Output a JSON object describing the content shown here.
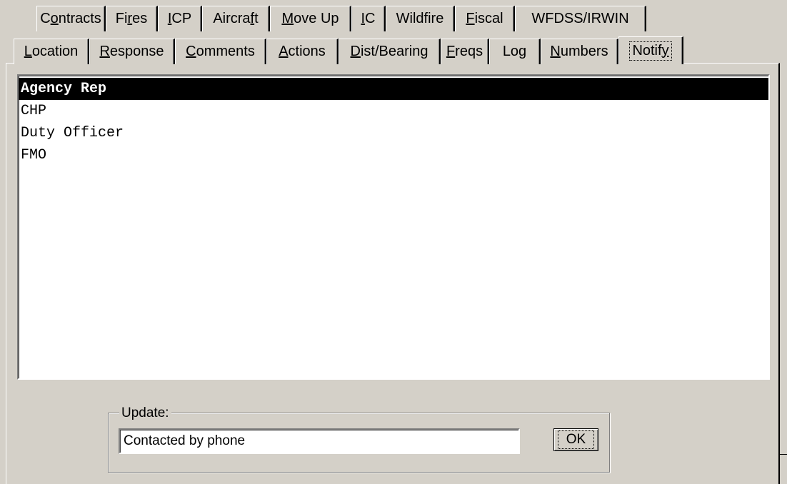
{
  "tabs_top": [
    {
      "pre": "C",
      "key": "o",
      "post": "ntracts"
    },
    {
      "pre": "Fi",
      "key": "r",
      "post": "es"
    },
    {
      "pre": "",
      "key": "I",
      "post": "CP"
    },
    {
      "pre": "Aircra",
      "key": "f",
      "post": "t"
    },
    {
      "pre": "",
      "key": "M",
      "post": "ove Up"
    },
    {
      "pre": "",
      "key": "I",
      "post": "C"
    },
    {
      "pre": "Wildfire",
      "key": "",
      "post": ""
    },
    {
      "pre": "",
      "key": "F",
      "post": "iscal"
    },
    {
      "pre": "WFDSS/IRWIN",
      "key": "",
      "post": ""
    }
  ],
  "tabs_bottom": [
    {
      "pre": "",
      "key": "L",
      "post": "ocation"
    },
    {
      "pre": "",
      "key": "R",
      "post": "esponse"
    },
    {
      "pre": "",
      "key": "C",
      "post": "omments"
    },
    {
      "pre": "",
      "key": "A",
      "post": "ctions"
    },
    {
      "pre": "",
      "key": "D",
      "post": "ist/Bearing"
    },
    {
      "pre": "",
      "key": "F",
      "post": "reqs"
    },
    {
      "pre": "Log",
      "key": "",
      "post": ""
    },
    {
      "pre": "",
      "key": "N",
      "post": "umbers"
    },
    {
      "pre": "Notif",
      "key": "y",
      "post": ""
    }
  ],
  "active_tab": "Notify",
  "notify_list": [
    "Agency Rep",
    "CHP",
    "Duty Officer",
    "FMO"
  ],
  "selected_item": "Agency Rep",
  "update": {
    "label": "Update:",
    "value": "Contacted by phone"
  },
  "ok_label": "OK"
}
